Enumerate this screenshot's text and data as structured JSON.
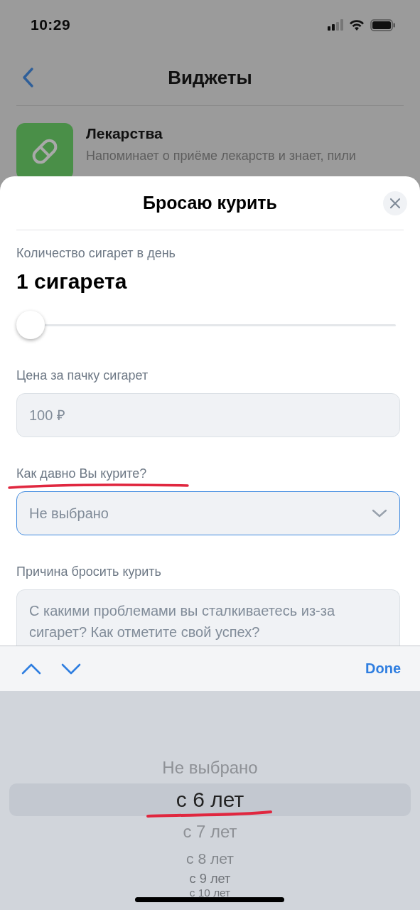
{
  "status_bar": {
    "time": "10:29"
  },
  "nav": {
    "title": "Виджеты"
  },
  "widget": {
    "title": "Лекарства",
    "description": "Напоминает о приёме лекарств и знает, пили"
  },
  "sheet": {
    "title": "Бросаю курить",
    "fields": [
      {
        "kind": "slider",
        "label": "Количество сигарет в день",
        "value": "1 сигарета",
        "level": 0
      },
      {
        "kind": "input",
        "label": "Цена за пачку сигарет",
        "placeholder": "100 ₽"
      },
      {
        "kind": "select",
        "label": "Как давно Вы курите?",
        "value": "Не выбрано",
        "focused": true
      },
      {
        "kind": "textarea",
        "label": "Причина бросить курить",
        "placeholder": "С какими проблемами вы сталкиваетесь из-за сигарет? Как отметите свой успех?"
      }
    ]
  },
  "keyboard_toolbar": {
    "done": "Done"
  },
  "picker": {
    "options": [
      {
        "label": "Не выбрано",
        "selected": false
      },
      {
        "label": "с 6 лет",
        "selected": true
      },
      {
        "label": "с 7 лет",
        "selected": false
      },
      {
        "label": "с 8 лет",
        "selected": false
      },
      {
        "label": "с 9 лет",
        "selected": false
      },
      {
        "label": "с 10 лет",
        "selected": false
      }
    ]
  }
}
